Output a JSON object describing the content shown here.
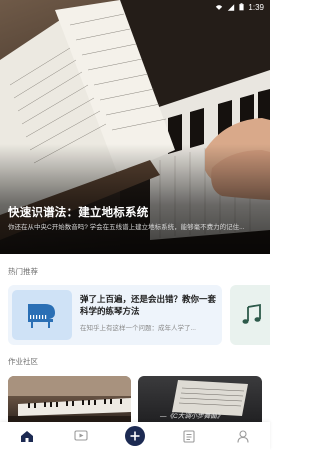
{
  "status_bar": {
    "time": "1:39"
  },
  "hero": {
    "title": "快速识谱法：建立地标系统",
    "subtitle": "你还在从中央C开始数音吗? 学会在五线谱上建立地标系统，能够毫不费力的记住..."
  },
  "hot": {
    "section_title": "热门推荐",
    "card": {
      "title": "弹了上百遍，还是会出错？教你一套科学的练琴方法",
      "desc": "在知乎上有这样一个问题：成年人学了..."
    }
  },
  "works": {
    "section_title": "作业社区",
    "item2_caption": "—《C大调小步舞曲》"
  },
  "tabbar": {
    "items": [
      "home-icon",
      "video-icon",
      "add-icon",
      "document-icon",
      "profile-icon"
    ],
    "active_color": "#1c2a52",
    "inactive_color": "#9a9a9a"
  },
  "colors": {
    "accent": "#1c2a52",
    "card_bg": "#eef4fb"
  }
}
